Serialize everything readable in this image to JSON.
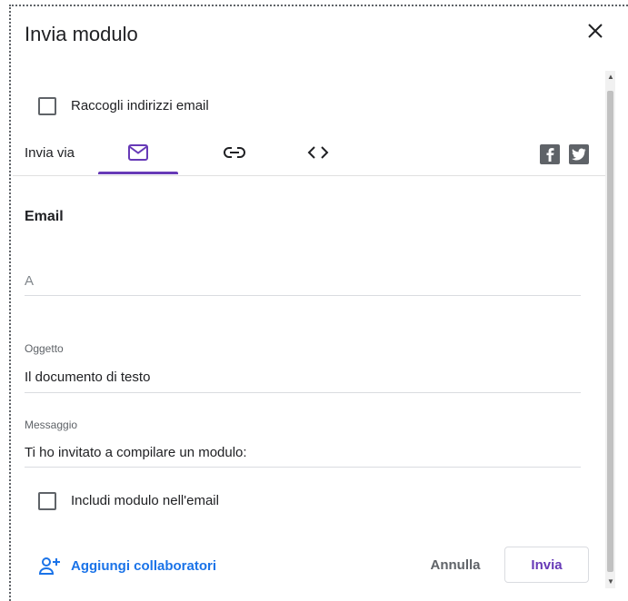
{
  "dialog": {
    "title": "Invia modulo"
  },
  "collect_emails": {
    "label": "Raccogli indirizzi email",
    "checked": false
  },
  "send_via": {
    "label": "Invia via",
    "tabs": [
      {
        "icon": "email-icon",
        "active": true
      },
      {
        "icon": "link-icon",
        "active": false
      },
      {
        "icon": "embed-code-icon",
        "active": false
      }
    ],
    "social": [
      "facebook-icon",
      "twitter-icon"
    ]
  },
  "email_section": {
    "title": "Email",
    "to": {
      "placeholder": "A",
      "value": ""
    },
    "subject": {
      "label": "Oggetto",
      "value": "Il documento di testo"
    },
    "message": {
      "label": "Messaggio",
      "value": "Ti ho invitato a compilare un modulo:"
    },
    "include_form": {
      "label": "Includi modulo nell'email",
      "checked": false
    }
  },
  "footer": {
    "add_collaborators": "Aggiungi collaboratori",
    "cancel": "Annulla",
    "send": "Invia"
  },
  "colors": {
    "accent": "#673ab7",
    "link": "#1a73e8",
    "text": "#202124",
    "muted": "#5f6368"
  }
}
